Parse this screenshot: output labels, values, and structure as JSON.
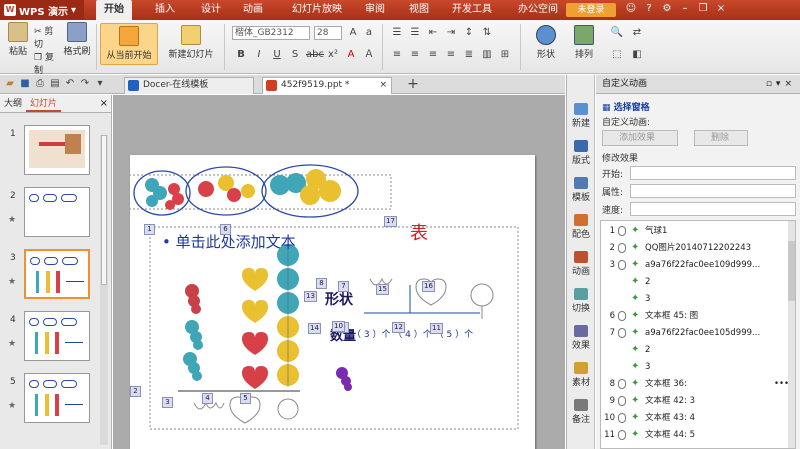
{
  "titlebar": {
    "app_name": "WPS 演示",
    "tabs": [
      "开始",
      "插入",
      "设计",
      "动画",
      "幻灯片放映",
      "审阅",
      "视图",
      "开发工具",
      "办公空间"
    ],
    "active_tab": "开始",
    "login_label": "未登录",
    "accent_color": "#c8482c"
  },
  "ribbon": {
    "paste_label": "粘贴",
    "cut_label": "剪切",
    "copy_label": "复制",
    "format_painter_label": "格式刷",
    "from_current_label": "从当前开始",
    "new_slide_label": "新建幻灯片",
    "font_name": "楷体_GB2312",
    "font_size": "28",
    "shape_label": "形状",
    "arrange_label": "排列"
  },
  "tabs": [
    {
      "label": "Docer-在线模板",
      "icon": "docer-icon"
    },
    {
      "label": "452f9519.ppt *",
      "icon": "ppt-file-icon"
    }
  ],
  "left_panel": {
    "tab_outline": "大纲",
    "tab_slides": "幻灯片",
    "close": "×",
    "slides": [
      {
        "num": "1",
        "active": false
      },
      {
        "num": "2",
        "active": false
      },
      {
        "num": "3",
        "active": true
      },
      {
        "num": "4",
        "active": false
      },
      {
        "num": "5",
        "active": false
      }
    ]
  },
  "slide": {
    "bullet_text": "• 单击此处添加文本",
    "shape_label": "形状",
    "count_label": "数量",
    "table_label": "表",
    "count_row": "（ 3 ）个 （ 4 ）个 （ 5 ）个",
    "anim_numbers": [
      "1",
      "2",
      "3",
      "4",
      "5",
      "6",
      "7",
      "8",
      "9",
      "10",
      "11",
      "12",
      "13",
      "14",
      "15",
      "16",
      "17"
    ]
  },
  "side_icons": [
    "新建",
    "版式",
    "模板",
    "配色",
    "动画",
    "切换",
    "效果",
    "素材",
    "备注"
  ],
  "task_pane": {
    "title": "自定义动画",
    "select_pane": "选择窗格",
    "custom_anim": "自定义动画:",
    "add_effect": "添加效果",
    "delete": "删除",
    "modify_effect": "修改效果",
    "start_label": "开始:",
    "property_label": "属性:",
    "speed_label": "速度:",
    "items": [
      {
        "n": "1",
        "text": "气球1",
        "sub": false,
        "more": false
      },
      {
        "n": "2",
        "text": "QQ图片20140712202243",
        "sub": false,
        "more": false
      },
      {
        "n": "3",
        "text": "a9a76f22fac0ee109d999...",
        "sub": false,
        "more": false
      },
      {
        "n": "",
        "text": "2",
        "sub": true,
        "more": false
      },
      {
        "n": "",
        "text": "3",
        "sub": true,
        "more": false
      },
      {
        "n": "6",
        "text": "文本框 45: 图",
        "sub": false,
        "more": false
      },
      {
        "n": "7",
        "text": "a9a76f22fac0ee105d999...",
        "sub": false,
        "more": false
      },
      {
        "n": "",
        "text": "2",
        "sub": true,
        "more": false
      },
      {
        "n": "",
        "text": "3",
        "sub": true,
        "more": false
      },
      {
        "n": "8",
        "text": "文本框 36:",
        "sub": false,
        "more": true
      },
      {
        "n": "9",
        "text": "文本框 42: 3",
        "sub": false,
        "more": false
      },
      {
        "n": "10",
        "text": "文本框 43: 4",
        "sub": false,
        "more": false
      },
      {
        "n": "11",
        "text": "文本框 44: 5",
        "sub": false,
        "more": false
      }
    ]
  }
}
